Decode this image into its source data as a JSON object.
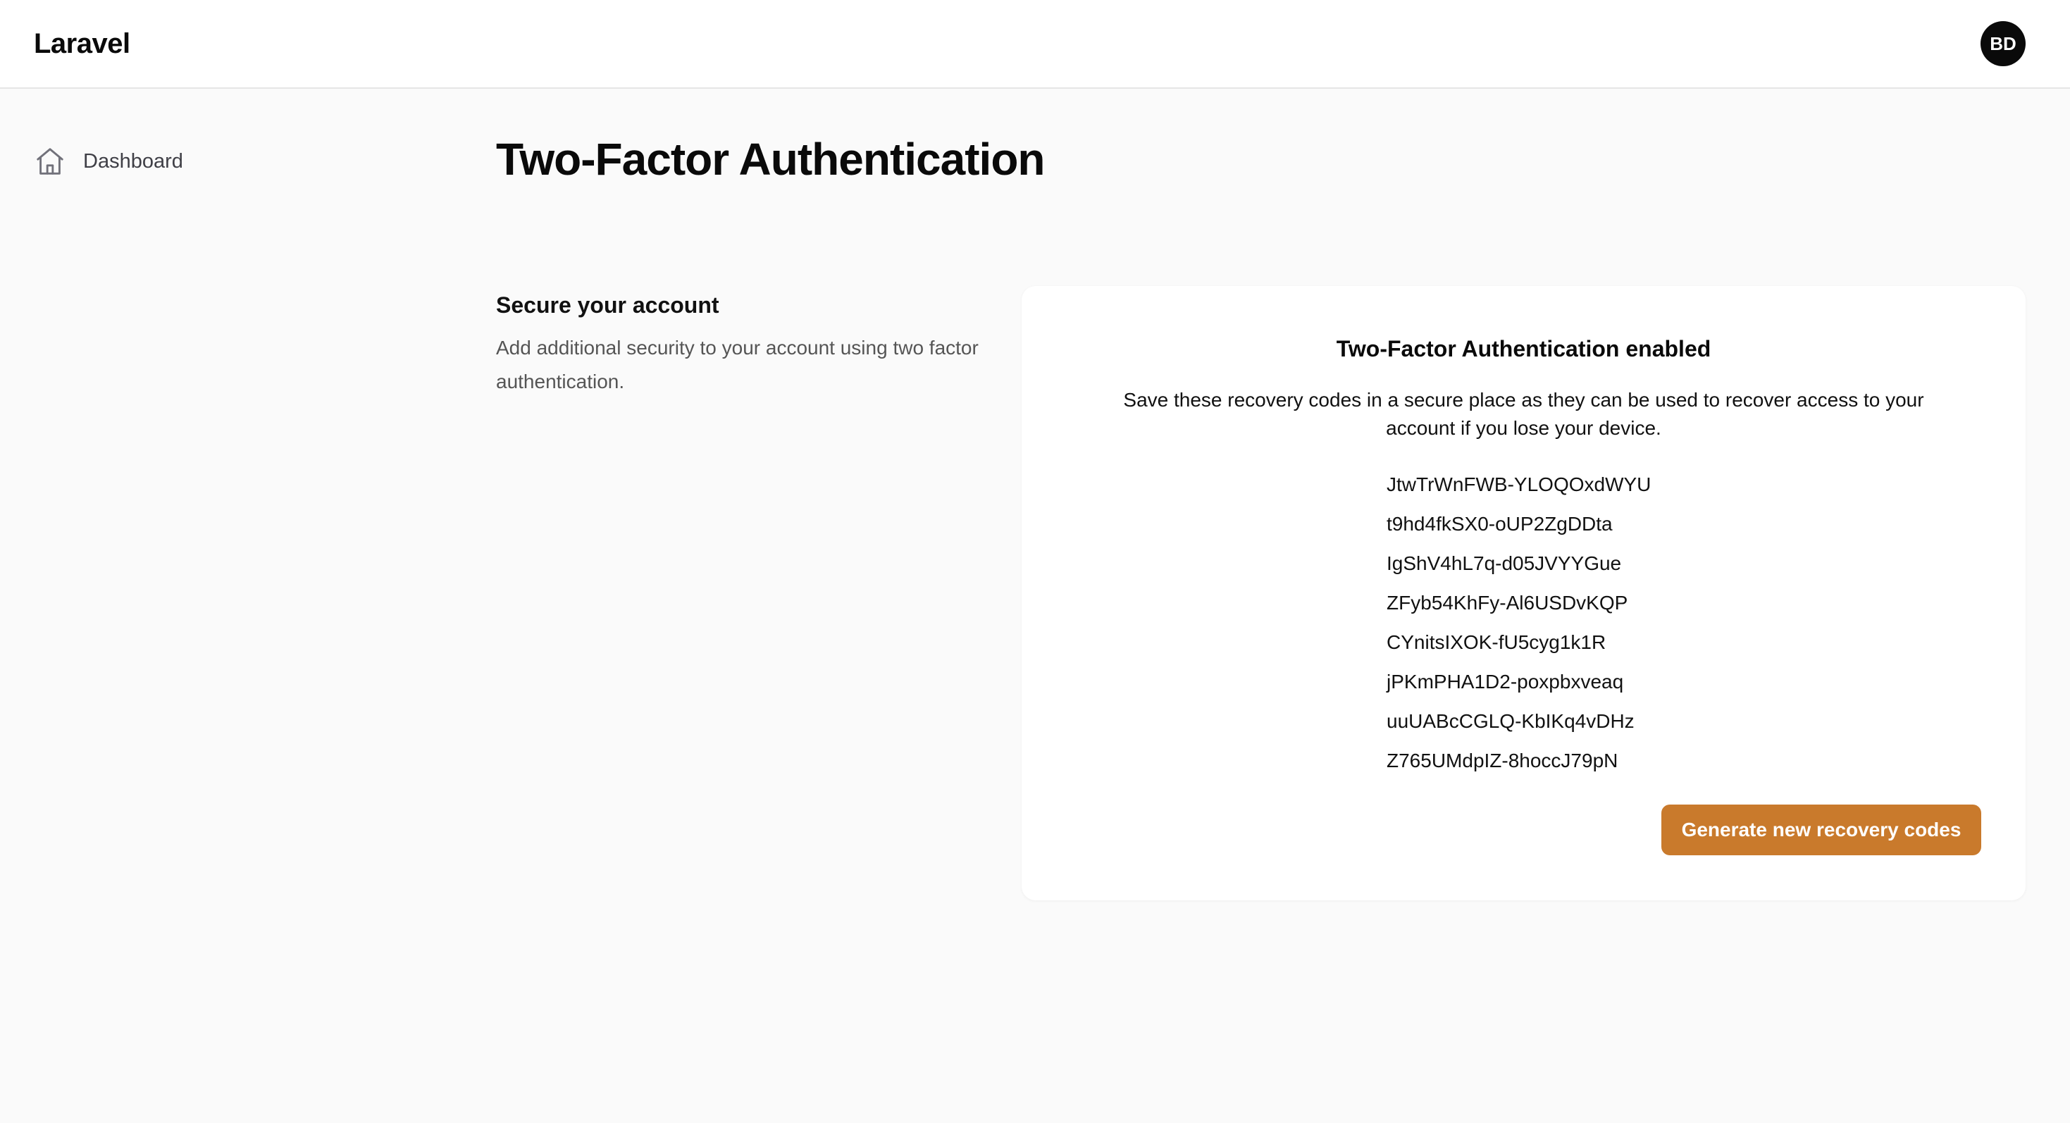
{
  "header": {
    "brand": "Laravel",
    "avatar_initials": "BD"
  },
  "sidebar": {
    "items": [
      {
        "label": "Dashboard",
        "icon": "home-icon"
      }
    ]
  },
  "main": {
    "page_title": "Two-Factor Authentication",
    "section": {
      "title": "Secure your account",
      "description": "Add additional security to your account using two factor authentication."
    },
    "card": {
      "title": "Two-Factor Authentication enabled",
      "description": "Save these recovery codes in a secure place as they can be used to recover access to your account if you lose your device.",
      "recovery_codes": [
        "JtwTrWnFWB-YLOQOxdWYU",
        "t9hd4fkSX0-oUP2ZgDDta",
        "IgShV4hL7q-d05JVYYGue",
        "ZFyb54KhFy-Al6USDvKQP",
        "CYnitsIXOK-fU5cyg1k1R",
        "jPKmPHA1D2-poxpbxveaq",
        "uuUABcCGLQ-KbIKq4vDHz",
        "Z765UMdpIZ-8hoccJ79pN"
      ],
      "generate_button_label": "Generate new recovery codes"
    }
  },
  "colors": {
    "accent": "#c97a2c",
    "background": "#fafafa",
    "card": "#ffffff",
    "avatar": "#0a0a0a"
  }
}
